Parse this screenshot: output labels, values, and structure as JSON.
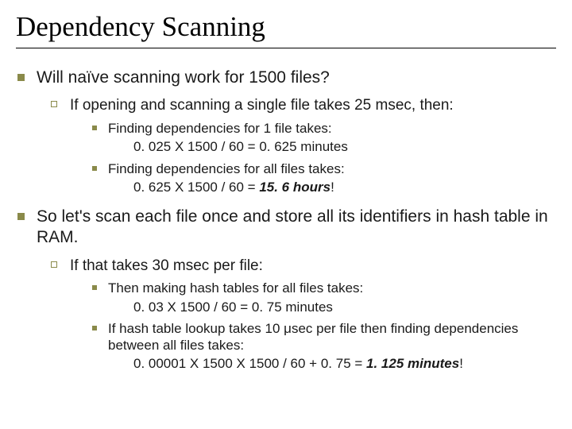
{
  "title": "Dependency Scanning",
  "b1": {
    "text": "Will naïve scanning work for 1500 files?",
    "sub": {
      "text": "If opening and scanning a single file takes 25 msec, then:",
      "p1_a": "Finding dependencies for 1 file takes:",
      "p1_b": "0. 025 X 1500 / 60 = 0. 625 minutes",
      "p2_a": "Finding dependencies for all files takes:",
      "p2_b_pre": "0. 625 X 1500 / 60 = ",
      "p2_b_val": "15. 6 hours",
      "p2_b_post": "!"
    }
  },
  "b2": {
    "text": "So let's scan each file once and store all its identifiers in hash table in RAM.",
    "sub": {
      "text": "If that takes 30 msec per file:",
      "p1_a": "Then making hash tables for all files takes:",
      "p1_b": "0. 03 X 1500 / 60 = 0. 75 minutes",
      "p2_a1": "If hash table lookup takes 10 ",
      "p2_a_mu": "μ",
      "p2_a2": "sec per file then finding dependencies between all files takes:",
      "p2_b_pre": "0. 00001 X 1500 X 1500 / 60 + 0. 75 = ",
      "p2_b_val": "1. 125 minutes",
      "p2_b_post": "!"
    }
  }
}
